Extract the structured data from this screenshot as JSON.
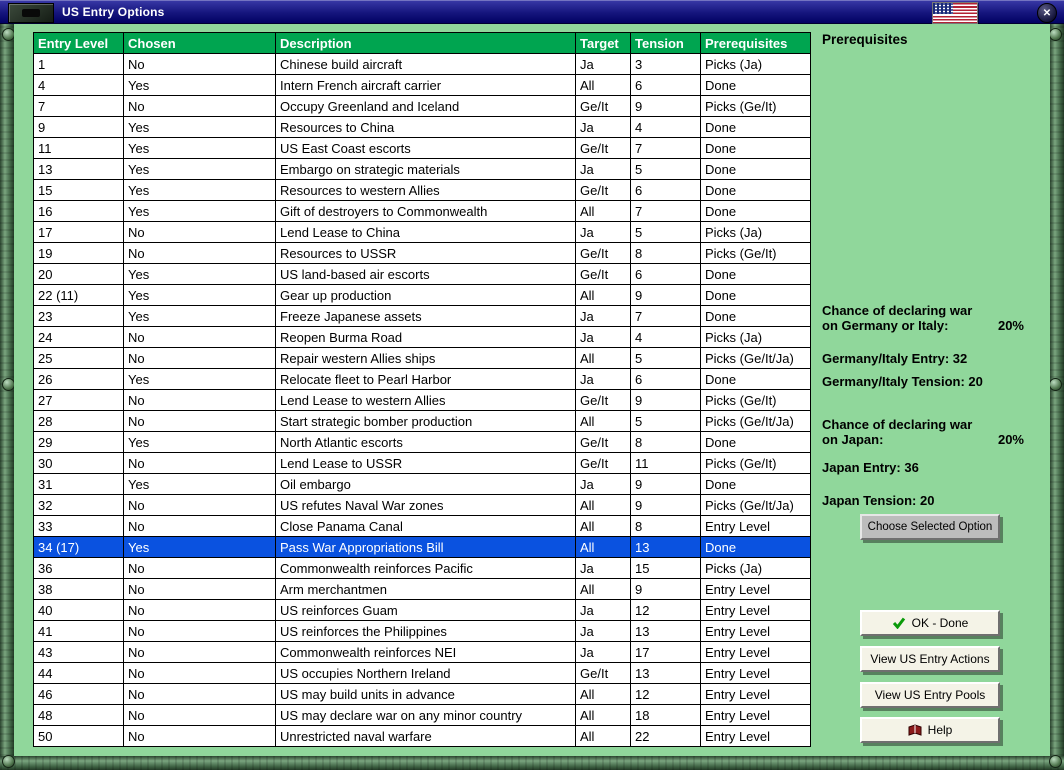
{
  "colors": {
    "header_green": "#00a550",
    "selected_blue": "#0a52e0",
    "background_green": "#90d79b",
    "titlebar_navy": "#14147c"
  },
  "window": {
    "title": "US Entry Options",
    "close_label": "✕"
  },
  "table": {
    "headers": [
      "Entry Level",
      "Chosen",
      "Description",
      "Target",
      "Tension",
      "Prerequisites"
    ],
    "selected_index": 23,
    "rows": [
      [
        "1",
        "No",
        "Chinese build aircraft",
        "Ja",
        "3",
        "Picks (Ja)"
      ],
      [
        "4",
        "Yes",
        "Intern French aircraft carrier",
        "All",
        "6",
        "Done"
      ],
      [
        "7",
        "No",
        "Occupy Greenland and Iceland",
        "Ge/It",
        "9",
        "Picks (Ge/It)"
      ],
      [
        "9",
        "Yes",
        "Resources to China",
        "Ja",
        "4",
        "Done"
      ],
      [
        "11",
        "Yes",
        "US East Coast escorts",
        "Ge/It",
        "7",
        "Done"
      ],
      [
        "13",
        "Yes",
        "Embargo on strategic materials",
        "Ja",
        "5",
        "Done"
      ],
      [
        "15",
        "Yes",
        "Resources to western Allies",
        "Ge/It",
        "6",
        "Done"
      ],
      [
        "16",
        "Yes",
        "Gift of destroyers to Commonwealth",
        "All",
        "7",
        "Done"
      ],
      [
        "17",
        "No",
        "Lend Lease to China",
        "Ja",
        "5",
        "Picks (Ja)"
      ],
      [
        "19",
        "No",
        "Resources to USSR",
        "Ge/It",
        "8",
        "Picks (Ge/It)"
      ],
      [
        "20",
        "Yes",
        "US land-based air escorts",
        "Ge/It",
        "6",
        "Done"
      ],
      [
        "22 (11)",
        "Yes",
        "Gear up production",
        "All",
        "9",
        "Done"
      ],
      [
        "23",
        "Yes",
        "Freeze Japanese assets",
        "Ja",
        "7",
        "Done"
      ],
      [
        "24",
        "No",
        "Reopen Burma Road",
        "Ja",
        "4",
        "Picks (Ja)"
      ],
      [
        "25",
        "No",
        "Repair western Allies ships",
        "All",
        "5",
        "Picks (Ge/It/Ja)"
      ],
      [
        "26",
        "Yes",
        "Relocate fleet to Pearl Harbor",
        "Ja",
        "6",
        "Done"
      ],
      [
        "27",
        "No",
        "Lend Lease to western Allies",
        "Ge/It",
        "9",
        "Picks (Ge/It)"
      ],
      [
        "28",
        "No",
        "Start strategic bomber production",
        "All",
        "5",
        "Picks (Ge/It/Ja)"
      ],
      [
        "29",
        "Yes",
        "North Atlantic escorts",
        "Ge/It",
        "8",
        "Done"
      ],
      [
        "30",
        "No",
        "Lend Lease to USSR",
        "Ge/It",
        "11",
        "Picks (Ge/It)"
      ],
      [
        "31",
        "Yes",
        "Oil embargo",
        "Ja",
        "9",
        "Done"
      ],
      [
        "32",
        "No",
        "US refutes Naval War zones",
        "All",
        "9",
        "Picks (Ge/It/Ja)"
      ],
      [
        "33",
        "No",
        "Close Panama Canal",
        "All",
        "8",
        "Entry Level"
      ],
      [
        "34 (17)",
        "Yes",
        "Pass War Appropriations Bill",
        "All",
        "13",
        "Done"
      ],
      [
        "36",
        "No",
        "Commonwealth reinforces Pacific",
        "Ja",
        "15",
        "Picks (Ja)"
      ],
      [
        "38",
        "No",
        "Arm merchantmen",
        "All",
        "9",
        "Entry Level"
      ],
      [
        "40",
        "No",
        "US reinforces Guam",
        "Ja",
        "12",
        "Entry Level"
      ],
      [
        "41",
        "No",
        "US reinforces the Philippines",
        "Ja",
        "13",
        "Entry Level"
      ],
      [
        "43",
        "No",
        "Commonwealth reinforces NEI",
        "Ja",
        "17",
        "Entry Level"
      ],
      [
        "44",
        "No",
        "US occupies Northern Ireland",
        "Ge/It",
        "13",
        "Entry Level"
      ],
      [
        "46",
        "No",
        "US may build units in advance",
        "All",
        "12",
        "Entry Level"
      ],
      [
        "48",
        "No",
        "US may declare war on any minor country",
        "All",
        "18",
        "Entry Level"
      ],
      [
        "50",
        "No",
        "Unrestricted naval warfare",
        "All",
        "22",
        "Entry Level"
      ]
    ]
  },
  "panel": {
    "title": "Prerequisites",
    "germany": {
      "chance_line1": "Chance of declaring war",
      "chance_line2": "on Germany or Italy:",
      "chance_value": "20%",
      "entry": "Germany/Italy Entry: 32",
      "tension": "Germany/Italy Tension: 20"
    },
    "japan": {
      "chance_line1": "Chance of declaring war",
      "chance_line2": "on Japan:",
      "chance_value": "20%",
      "entry": "Japan Entry: 36",
      "tension": "Japan Tension: 20"
    },
    "choose_button": "Choose Selected Option",
    "ok_button": "OK - Done",
    "view_actions_button": "View US Entry Actions",
    "view_pools_button": "View US Entry Pools",
    "help_button": "Help"
  }
}
